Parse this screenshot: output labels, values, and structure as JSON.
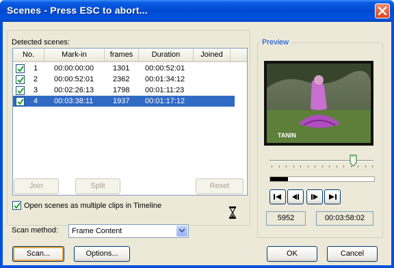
{
  "dialog": {
    "title": "Scenes - Press ESC to abort..."
  },
  "scenes": {
    "label": "Detected scenes:",
    "columns": [
      "No.",
      "Mark-in",
      "frames",
      "Duration",
      "Joined"
    ],
    "rows": [
      {
        "checked": true,
        "no": "1",
        "mark_in": "00:00:00:00",
        "frames": "1301",
        "duration": "00:00:52:01",
        "joined": "",
        "selected": false
      },
      {
        "checked": true,
        "no": "2",
        "mark_in": "00:00:52:01",
        "frames": "2362",
        "duration": "00:01:34:12",
        "joined": "",
        "selected": false
      },
      {
        "checked": true,
        "no": "3",
        "mark_in": "00:02:26:13",
        "frames": "1798",
        "duration": "00:01:11:23",
        "joined": "",
        "selected": false
      },
      {
        "checked": true,
        "no": "4",
        "mark_in": "00:03:38:11",
        "frames": "1937",
        "duration": "00:01:17:12",
        "joined": "",
        "selected": true
      }
    ],
    "join_label": "Join",
    "split_label": "Split",
    "reset_label": "Reset"
  },
  "options": {
    "open_multiple_label": "Open scenes as multiple clips in Timeline",
    "open_multiple_checked": true,
    "scan_method_label": "Scan method:",
    "scan_method_value": "Frame Content"
  },
  "preview": {
    "label": "Preview",
    "caption": "TANIN",
    "position_fraction": 0.8,
    "progress_fraction": 0.17,
    "frame_value": "5952",
    "timecode_value": "00:03:58:02"
  },
  "transport": {
    "icons": [
      "skip-to-start-icon",
      "step-back-icon",
      "step-forward-icon",
      "skip-to-end-icon"
    ]
  },
  "buttons": {
    "scan_label": "Scan...",
    "options_label": "Options...",
    "ok_label": "OK",
    "cancel_label": "Cancel"
  },
  "colors": {
    "title_bar": "#0050dd",
    "selection": "#316ac5",
    "dialog_face": "#ece9d8",
    "close_button": "#d9461e"
  }
}
